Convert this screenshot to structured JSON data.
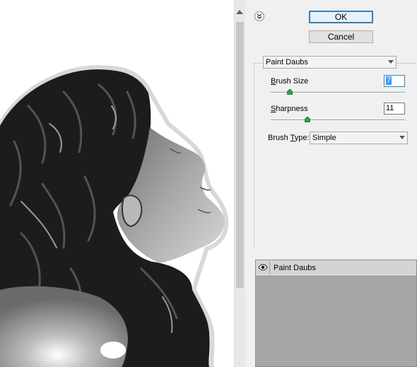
{
  "dialog": {
    "ok_label": "OK",
    "cancel_label": "Cancel",
    "collapse_icon": "double-chevron-down-icon"
  },
  "filter": {
    "selected": "Paint Daubs"
  },
  "params": {
    "brush_size": {
      "label_u": "B",
      "label_rest": "rush Size",
      "value": "7",
      "level": 7,
      "max": 50
    },
    "sharpness": {
      "label_u": "S",
      "label_rest": "harpness",
      "value": "11",
      "level": 11,
      "max": 40
    },
    "brush_type": {
      "label_pre": "Brush ",
      "label_u": "T",
      "label_rest": "ype:",
      "value": "Simple"
    }
  },
  "layers": {
    "effect_name": "Paint Daubs",
    "visibility_icon": "eye-icon"
  },
  "colors": {
    "ok_border": "#3c7fb1",
    "layers_bg": "#a7a7a7"
  }
}
